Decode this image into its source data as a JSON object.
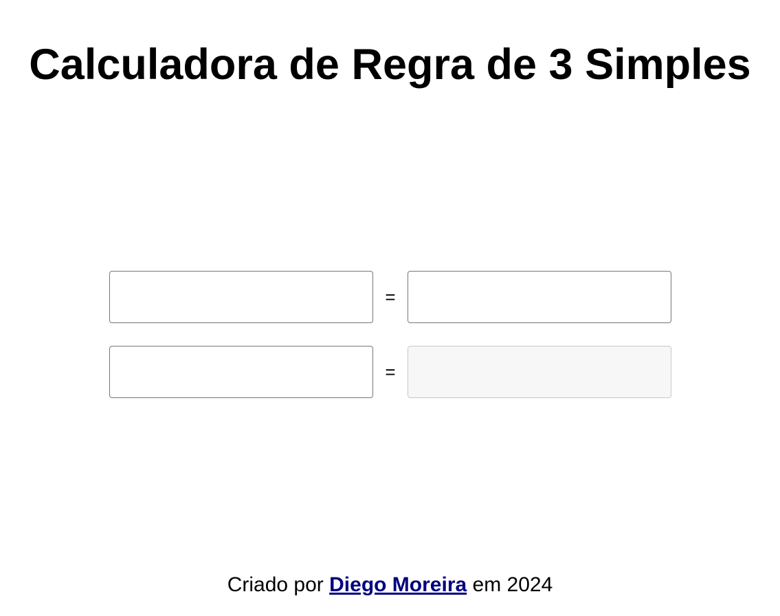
{
  "page": {
    "title": "Calculadora de Regra de 3 Simples"
  },
  "calculator": {
    "row1": {
      "left_value": "",
      "equals": "=",
      "right_value": ""
    },
    "row2": {
      "left_value": "",
      "equals": "=",
      "result_value": ""
    }
  },
  "footer": {
    "prefix": "Criado por",
    "author_link": "Diego Moreira",
    "suffix": "em 2024",
    "link_color": "#000080"
  }
}
